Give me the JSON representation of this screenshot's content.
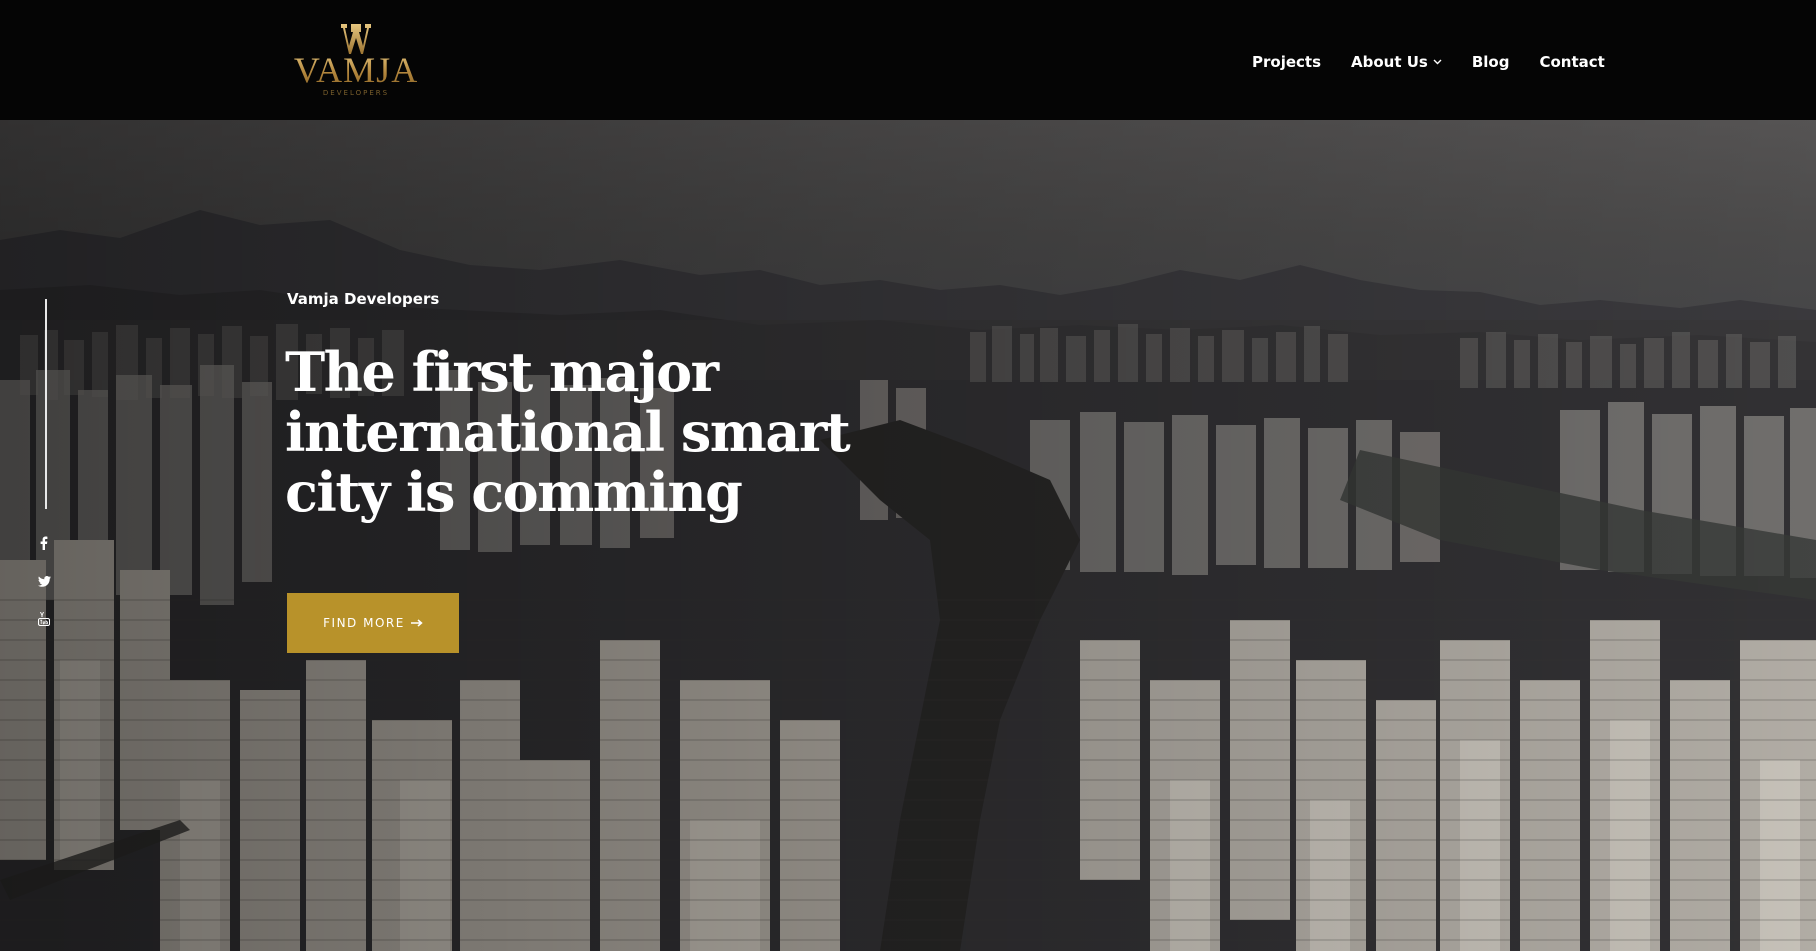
{
  "brand": {
    "name": "VAMJA",
    "tagline": "DEVELOPERS",
    "gold": "#c39b4c"
  },
  "nav": {
    "items": [
      {
        "label": "Projects",
        "has_dropdown": false
      },
      {
        "label": "About Us",
        "has_dropdown": true
      },
      {
        "label": "Blog",
        "has_dropdown": false
      },
      {
        "label": "Contact",
        "has_dropdown": false
      }
    ]
  },
  "hero": {
    "eyebrow": "Vamja Developers",
    "headline_lines": [
      "The first major",
      "international smart",
      "city is comming"
    ],
    "cta_label": "FIND MORE",
    "cta_icon": "long-arrow-right-icon",
    "cta_color": "#b8922a",
    "background": "aerial-city-photo"
  },
  "social": [
    {
      "name": "facebook",
      "icon": "facebook-icon"
    },
    {
      "name": "twitter",
      "icon": "twitter-icon"
    },
    {
      "name": "youtube",
      "icon": "youtube-icon"
    }
  ]
}
